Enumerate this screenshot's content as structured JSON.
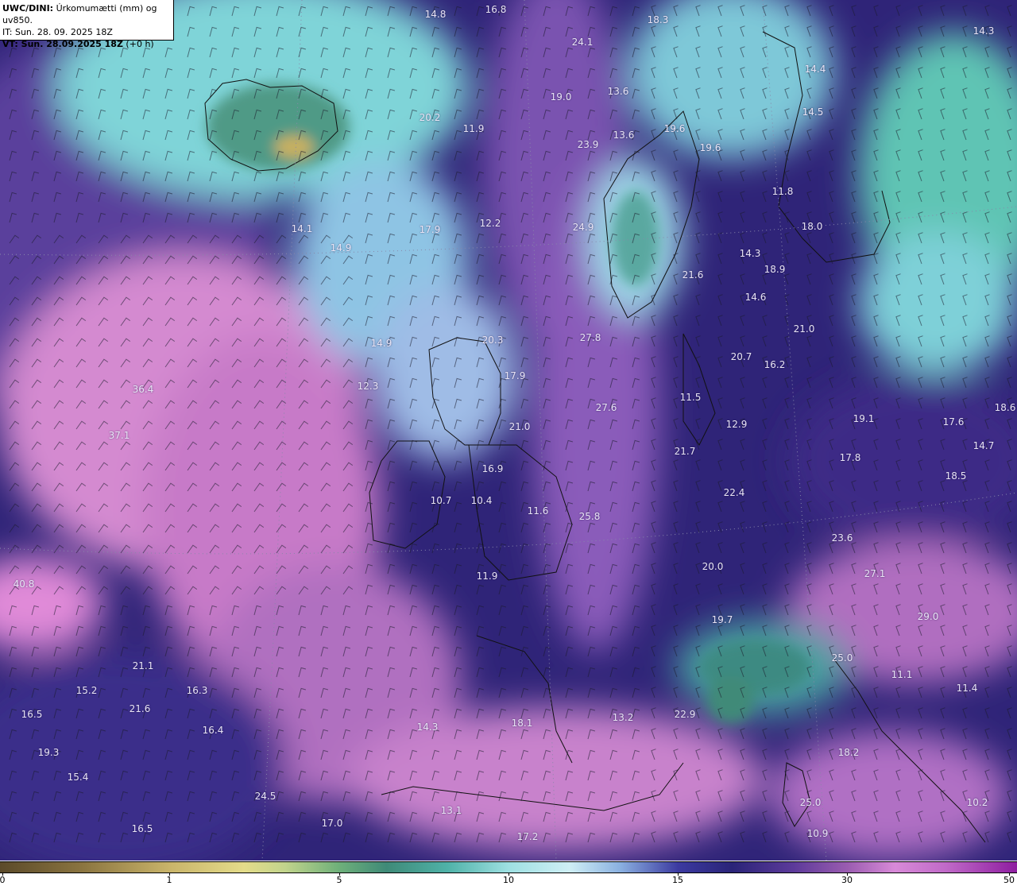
{
  "header": {
    "model": "UWC/DINI:",
    "title": " Úrkomumætti (mm) og uv850.",
    "init_time": "IT: Sun. 28. 09. 2025 18Z",
    "valid_time": "VT: Sun. 28.09.2025 18Z",
    "lead_time": " (+0 h)"
  },
  "colorbar": {
    "ticks": [
      "0",
      "1",
      "5",
      "10",
      "15",
      "30",
      "50"
    ],
    "colors": [
      "#5b4a2a",
      "#e4dc8a",
      "#6fb07a",
      "#9ee0e2",
      "#3c3aa0",
      "#9a5cb0",
      "#8e1ea0"
    ]
  },
  "map_values": [
    "14.8",
    "16.8",
    "18.3",
    "14.3",
    "24.1",
    "14.4",
    "19.0",
    "13.6",
    "14.5",
    "20.2",
    "11.9",
    "23.9",
    "13.6",
    "19.6",
    "19.6",
    "11.8",
    "17.9",
    "12.2",
    "24.9",
    "18.0",
    "14.1",
    "14.9",
    "14.3",
    "18.9",
    "21.6",
    "14.6",
    "21.0",
    "14.9",
    "20.3",
    "27.8",
    "20.7",
    "16.2",
    "12.3",
    "17.9",
    "27.6",
    "11.5",
    "12.9",
    "19.1",
    "17.6",
    "18.6",
    "21.0",
    "37.1",
    "21.7",
    "17.8",
    "14.7",
    "16.9",
    "18.5",
    "10.7",
    "10.4",
    "11.6",
    "25.8",
    "22.4",
    "23.6",
    "11.9",
    "27.1",
    "40.8",
    "19.7",
    "29.0",
    "21.1",
    "25.0",
    "15.2",
    "16.3",
    "11.1",
    "16.5",
    "21.6",
    "16.4",
    "14.3",
    "18.1",
    "13.2",
    "22.9",
    "19.3",
    "18.2",
    "15.4",
    "24.5",
    "17.0",
    "13.1",
    "17.2",
    "25.0",
    "10.2",
    "16.5",
    "10.9",
    "11.4",
    "20.0",
    "36.4"
  ]
}
